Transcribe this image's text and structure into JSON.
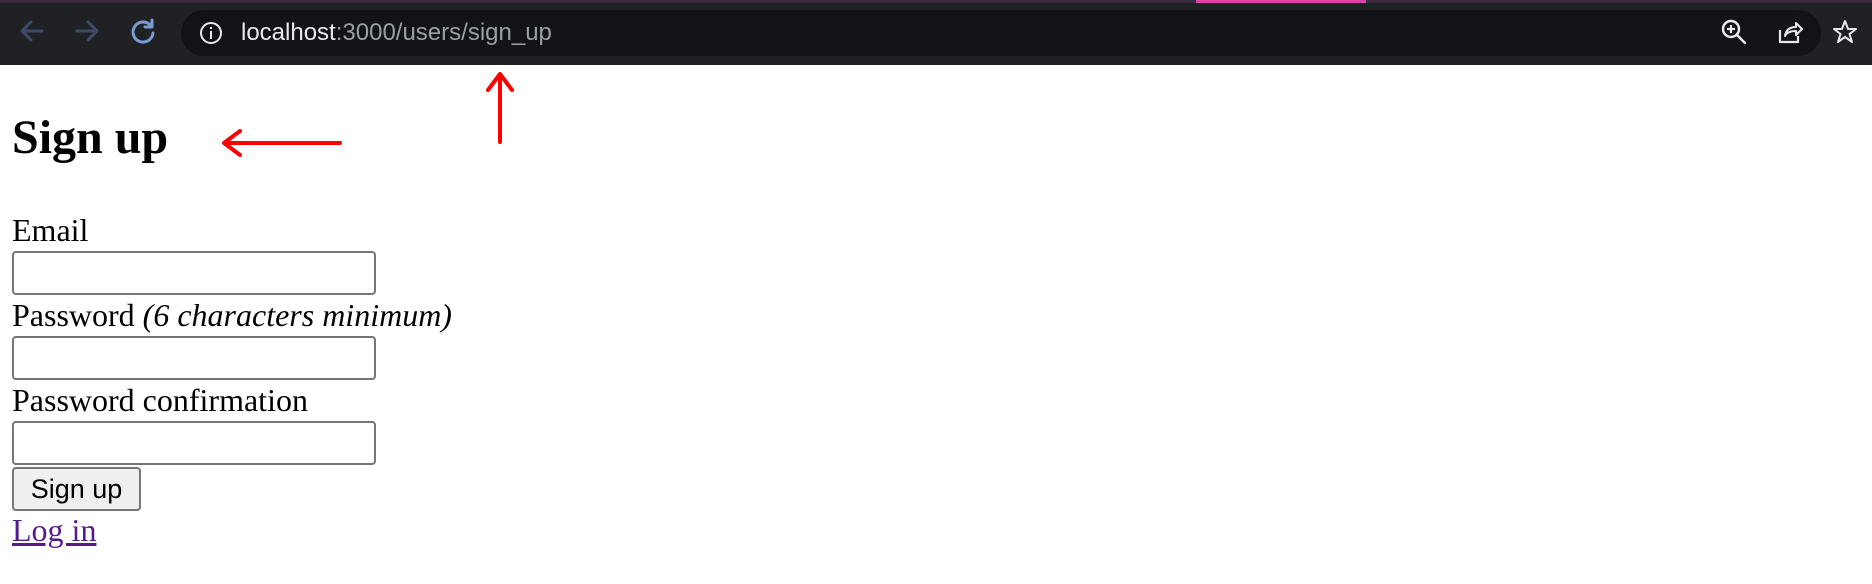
{
  "browser": {
    "url_host": "localhost",
    "url_path": ":3000/users/sign_up",
    "icons": {
      "back": "arrow-left-icon",
      "forward": "arrow-right-icon",
      "reload": "reload-icon",
      "site_info": "info-icon",
      "zoom": "zoom-in-icon",
      "share": "share-icon",
      "bookmark": "star-icon"
    }
  },
  "page": {
    "title": "Sign up",
    "email_label": "Email",
    "password_label": "Password",
    "password_hint": "(6 characters minimum)",
    "password_confirmation_label": "Password confirmation",
    "email_value": "",
    "password_value": "",
    "password_confirmation_value": "",
    "submit_label": "Sign up",
    "login_link": "Log in"
  },
  "annotations": {
    "arrow_color": "#ff0000",
    "arrows": [
      "left-arrow-pointing-at-title",
      "up-arrow-pointing-at-url"
    ]
  },
  "colors": {
    "chrome_bg": "#202124",
    "omnibox_bg": "#121317",
    "link_visited": "#551a8b",
    "tab_accent": "#e33fb0"
  }
}
